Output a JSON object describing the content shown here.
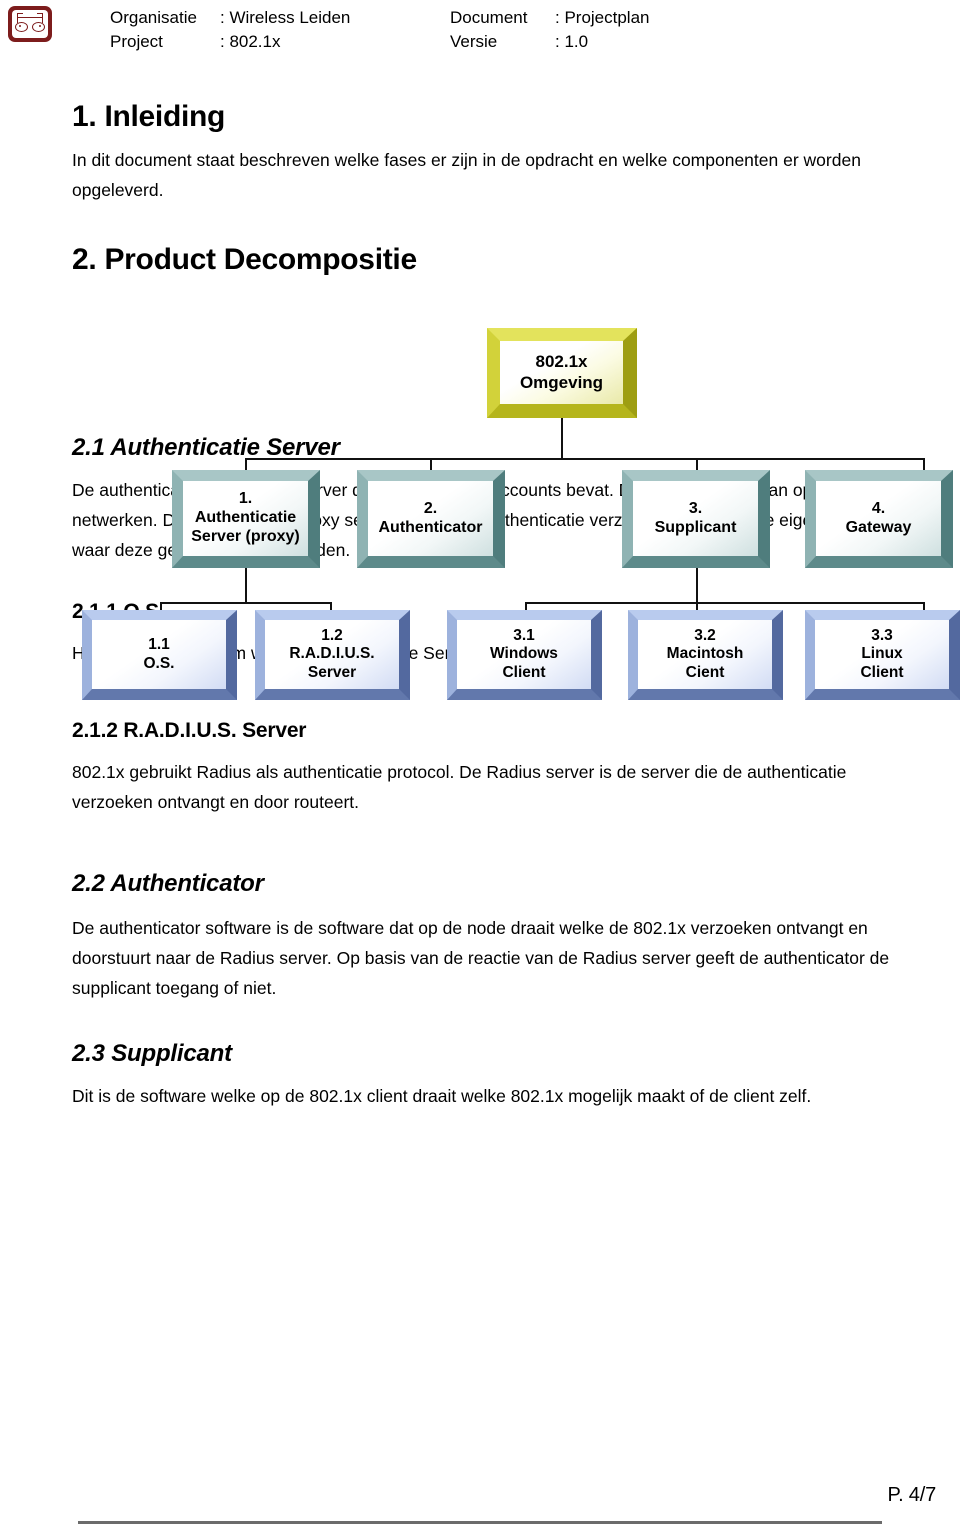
{
  "header": {
    "logo_icon": "wireless-leiden-logo-icon",
    "rows": [
      {
        "label": "Organisatie",
        "value": ": Wireless Leiden",
        "label2": "Document",
        "value2": ": Projectplan"
      },
      {
        "label": "Project",
        "value": ": 802.1x",
        "label2": "Versie",
        "value2": ": 1.0"
      }
    ]
  },
  "sections": {
    "s1_heading": "1. Inleiding",
    "s1_body": "In dit document staat beschreven welke fases er zijn in de opdracht en welke componenten er worden opgeleverd.",
    "s2_heading": "2. Product Decompositie",
    "s21_heading": "2.1 Authenticatie Server",
    "s21_body": "De authenticatie server is de server die de gebruikers accounts bevat. Deze gegevens staan op de eigen netwerken. De Authenticatie Proxy server verwijst de authenticatie verzoeken door naar de eigen netwerken waar deze geauthentiseerd worden.",
    "s211_heading": "2.1.1 O.S.",
    "s211_body": "Het besturing systeem waar de Authenticatie Server op draait.",
    "s212_heading": "2.1.2 R.A.D.I.U.S. Server",
    "s212_body": "802.1x gebruikt Radius als authenticatie protocol. De Radius server is de server die de authenticatie verzoeken ontvangt en door routeert.",
    "s22_heading": "2.2  Authenticator",
    "s22_body": "De authenticator software is de software dat op de node draait welke de 802.1x verzoeken ontvangt en doorstuurt naar de Radius server. Op basis van de reactie van de Radius server geeft de authenticator de supplicant toegang of niet.",
    "s23_heading": "2.3 Supplicant",
    "s23_body": "Dit is de software welke op de 802.1x client draait welke 802.1x mogelijk maakt of de client zelf."
  },
  "chart_data": {
    "type": "diagram",
    "title": "Product Decompositie — 802.1x Omgeving",
    "orientation": "top-down tree",
    "levels": 3,
    "colors": {
      "level1_bevel": "#c8c81e",
      "level2_bevel": "#7ba3a3",
      "level3_bevel": "#8fa8dc",
      "connector": "#111111"
    },
    "nodes": {
      "root": {
        "line1": "802.1x",
        "line2": "Omgeving"
      },
      "level2": [
        {
          "line1": "1.",
          "line2": "Authenticatie",
          "line3": "Server (proxy)"
        },
        {
          "line1": "2.",
          "line2": "Authenticator",
          "line3": ""
        },
        {
          "line1": "3.",
          "line2": "Supplicant",
          "line3": ""
        },
        {
          "line1": "4.",
          "line2": "Gateway",
          "line3": ""
        }
      ],
      "level3": [
        {
          "line1": "1.1",
          "line2": "O.S.",
          "line3": ""
        },
        {
          "line1": "1.2",
          "line2": "R.A.D.I.U.S.",
          "line3": "Server"
        },
        {
          "line1": "3.1",
          "line2": "Windows",
          "line3": "Client"
        },
        {
          "line1": "3.2",
          "line2": "Macintosh",
          "line3": "Cient"
        },
        {
          "line1": "3.3",
          "line2": "Linux",
          "line3": "Client"
        }
      ]
    },
    "edges": [
      {
        "from": "802.1x Omgeving",
        "to": "1. Authenticatie Server (proxy)"
      },
      {
        "from": "802.1x Omgeving",
        "to": "2. Authenticator"
      },
      {
        "from": "802.1x Omgeving",
        "to": "3. Supplicant"
      },
      {
        "from": "802.1x Omgeving",
        "to": "4. Gateway"
      },
      {
        "from": "1. Authenticatie Server (proxy)",
        "to": "1.1 O.S."
      },
      {
        "from": "1. Authenticatie Server (proxy)",
        "to": "1.2 R.A.D.I.U.S. Server"
      },
      {
        "from": "3. Supplicant",
        "to": "3.1 Windows Client"
      },
      {
        "from": "3. Supplicant",
        "to": "3.2 Macintosh Cient"
      },
      {
        "from": "3. Supplicant",
        "to": "3.3 Linux Client"
      }
    ]
  },
  "footer": {
    "page": "P. 4/7"
  }
}
